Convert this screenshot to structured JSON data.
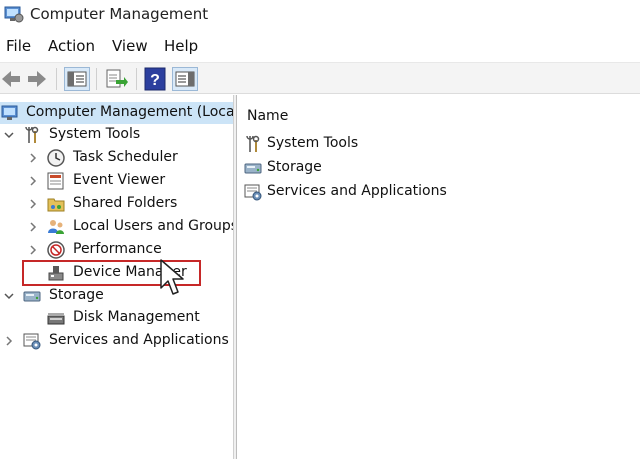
{
  "window": {
    "title": "Computer Management"
  },
  "menubar": {
    "items": [
      "File",
      "Action",
      "View",
      "Help"
    ]
  },
  "toolbar": {
    "buttons": [
      "back-icon",
      "forward-icon",
      "show-hide-console-tree-icon",
      "export-list-icon",
      "help-icon",
      "show-hide-action-pane-icon"
    ]
  },
  "tree": {
    "root": "Computer Management (Local",
    "system_tools": "System Tools",
    "system_tools_children": [
      "Task Scheduler",
      "Event Viewer",
      "Shared Folders",
      "Local Users and Groups",
      "Performance",
      "Device Manager"
    ],
    "storage": "Storage",
    "storage_children": [
      "Disk Management"
    ],
    "services": "Services and Applications"
  },
  "list": {
    "column_header": "Name",
    "items": [
      "System Tools",
      "Storage",
      "Services and Applications"
    ]
  },
  "colors": {
    "selection": "#cce4f7",
    "highlight_box": "#c62828"
  }
}
